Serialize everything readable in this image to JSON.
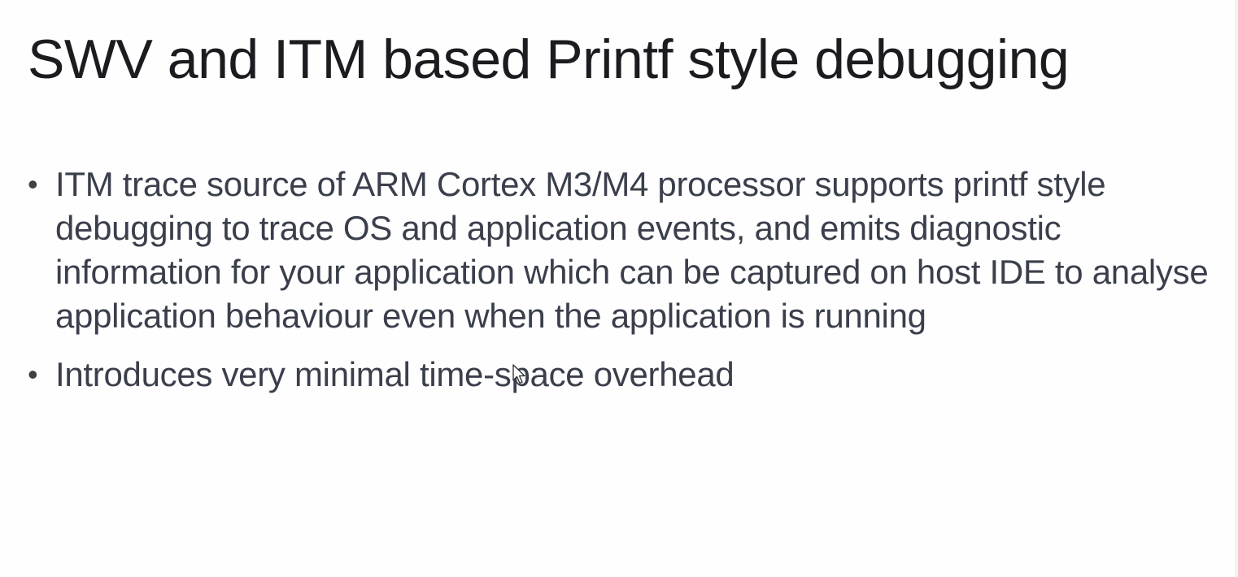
{
  "slide": {
    "title": "SWV and ITM based Printf style debugging",
    "bullets": [
      {
        "symbol": "•",
        "text": "ITM trace source of ARM Cortex M3/M4 processor supports printf style debugging to trace OS and application events, and emits diagnostic information for your application which can be captured on host IDE to analyse application behaviour even when the application is running"
      },
      {
        "symbol": "•",
        "text": "Introduces very minimal time-space overhead"
      }
    ]
  },
  "cursor": {
    "icon": "mouse-pointer-icon"
  },
  "colors": {
    "title": "#1c1c20",
    "body_text": "#3a3f4b",
    "background": "#fefeff"
  }
}
